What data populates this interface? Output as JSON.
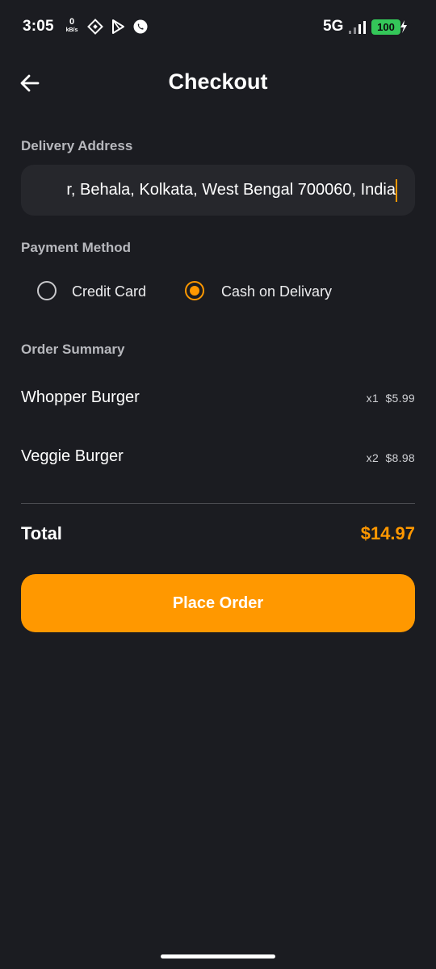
{
  "status_bar": {
    "time": "3:05",
    "net_speed_value": "0",
    "net_speed_unit": "kB/s",
    "icons": [
      "diamond-app-icon",
      "play-store-icon",
      "whatsapp-icon"
    ],
    "network": "5G",
    "battery": "100"
  },
  "header": {
    "title": "Checkout",
    "back_icon": "arrow-left-icon"
  },
  "delivery": {
    "label": "Delivery Address",
    "value": "r, Behala, Kolkata, West Bengal 700060, India"
  },
  "payment": {
    "label": "Payment Method",
    "options": [
      {
        "label": "Credit Card",
        "selected": false
      },
      {
        "label": "Cash on Delivary",
        "selected": true
      }
    ]
  },
  "summary": {
    "label": "Order Summary",
    "items": [
      {
        "name": "Whopper Burger",
        "qty": "x1",
        "price": "$5.99"
      },
      {
        "name": "Veggie Burger",
        "qty": "x2",
        "price": "$8.98"
      }
    ],
    "total_label": "Total",
    "total_value": "$14.97"
  },
  "actions": {
    "place_order": "Place Order"
  },
  "colors": {
    "background": "#1b1c21",
    "accent": "#ff9800",
    "field": "#26272c",
    "battery": "#34c759"
  }
}
